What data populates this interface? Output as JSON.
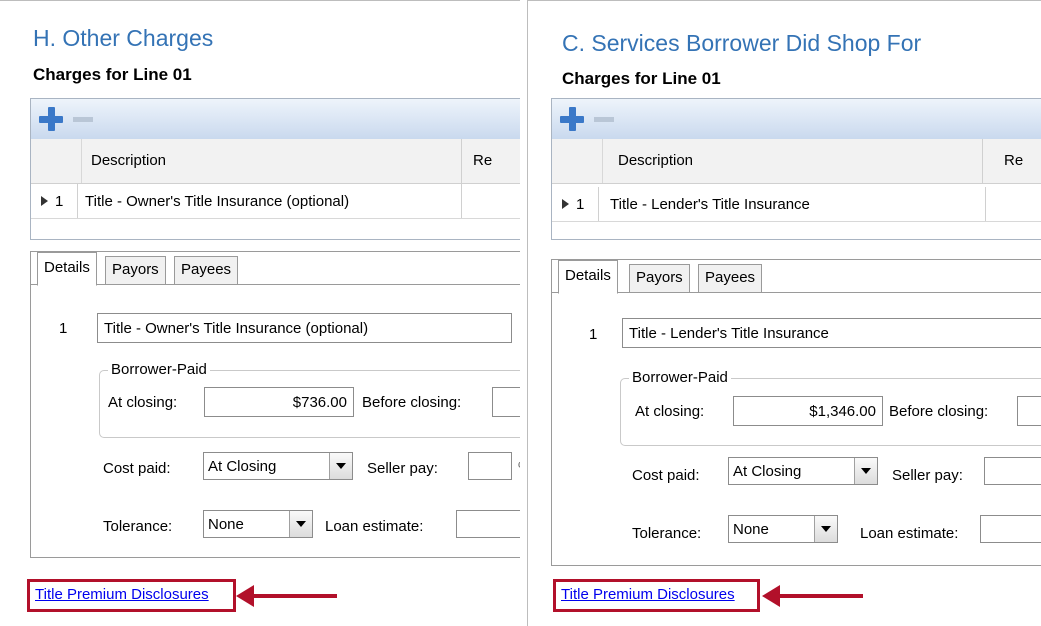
{
  "left": {
    "section_title": "H. Other Charges",
    "sub_title": "Charges for Line 01",
    "grid": {
      "col_description": "Description",
      "col_re": "Re",
      "row_num": "1",
      "row_description": "Title - Owner's Title Insurance (optional)"
    },
    "tabs": [
      "Details",
      "Payors",
      "Payees"
    ],
    "details": {
      "line_no": "1",
      "description_value": "Title - Owner's Title Insurance (optional)",
      "borrower_paid_legend": "Borrower-Paid",
      "at_closing_label": "At closing:",
      "at_closing_value": "$736.00",
      "before_closing_label": "Before closing:",
      "cost_paid_label": "Cost paid:",
      "cost_paid_value": "At Closing",
      "seller_pay_label": "Seller pay:",
      "tolerance_label": "Tolerance:",
      "tolerance_value": "None",
      "loan_estimate_label": "Loan estimate:",
      "pct_glyph": "%"
    },
    "link": "Title Premium Disclosures"
  },
  "right": {
    "section_title": "C. Services Borrower Did Shop For",
    "sub_title": "Charges for Line 01",
    "grid": {
      "col_description": "Description",
      "col_re": "Re",
      "row_num": "1",
      "row_description": "Title - Lender's Title Insurance"
    },
    "tabs": [
      "Details",
      "Payors",
      "Payees"
    ],
    "details": {
      "line_no": "1",
      "description_value": "Title - Lender's Title Insurance",
      "borrower_paid_legend": "Borrower-Paid",
      "at_closing_label": "At closing:",
      "at_closing_value": "$1,346.00",
      "before_closing_label": "Before closing:",
      "cost_paid_label": "Cost paid:",
      "cost_paid_value": "At Closing",
      "seller_pay_label": "Seller pay:",
      "tolerance_label": "Tolerance:",
      "tolerance_value": "None",
      "loan_estimate_label": "Loan estimate:"
    },
    "link": "Title Premium Disclosures"
  },
  "colors": {
    "title_blue": "#3473b5",
    "highlight_red": "#b2102a",
    "link_blue": "#0000ee"
  }
}
